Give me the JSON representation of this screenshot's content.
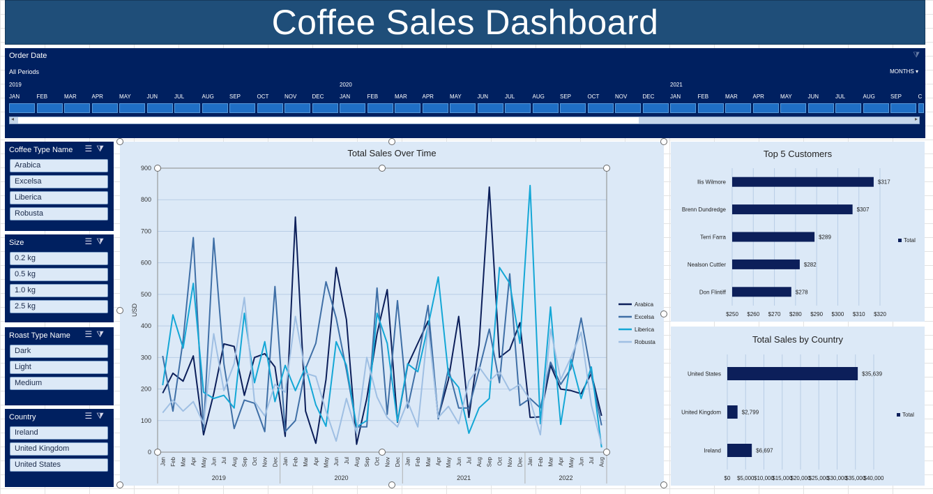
{
  "title": "Coffee Sales Dashboard",
  "timeline": {
    "header": "Order Date",
    "periods": "All Periods",
    "months_button": "MONTHS ▾",
    "years": [
      "2019",
      "2020",
      "2021"
    ],
    "months": [
      "JAN",
      "FEB",
      "MAR",
      "APR",
      "MAY",
      "JUN",
      "JUL",
      "AUG",
      "SEP",
      "OCT",
      "NOV",
      "DEC",
      "JAN",
      "FEB",
      "MAR",
      "APR",
      "MAY",
      "JUN",
      "JUL",
      "AUG",
      "SEP",
      "OCT",
      "NOV",
      "DEC",
      "JAN",
      "FEB",
      "MAR",
      "APR",
      "MAY",
      "JUN",
      "JUL",
      "AUG",
      "SEP",
      "C"
    ]
  },
  "slicers": [
    {
      "title": "Coffee Type Name",
      "items": [
        "Arabica",
        "Excelsa",
        "Liberica",
        "Robusta"
      ]
    },
    {
      "title": "Size",
      "items": [
        "0.2 kg",
        "0.5 kg",
        "1.0 kg",
        "2.5 kg"
      ]
    },
    {
      "title": "Roast Type Name",
      "items": [
        "Dark",
        "Light",
        "Medium"
      ]
    },
    {
      "title": "Country",
      "items": [
        "Ireland",
        "United Kingdom",
        "United States"
      ]
    }
  ],
  "chart_data": [
    {
      "type": "line",
      "title": "Total Sales Over Time",
      "ylabel": "USD",
      "ylim": [
        0,
        900
      ],
      "yticks": [
        "0",
        "100",
        "200",
        "300",
        "400",
        "500",
        "600",
        "700",
        "800",
        "900"
      ],
      "x": [
        "Jan",
        "Feb",
        "Mar",
        "Apr",
        "May",
        "Jun",
        "Jul",
        "Aug",
        "Sep",
        "Oct",
        "Nov",
        "Dec",
        "Jan",
        "Feb",
        "Mar",
        "Apr",
        "May",
        "Jun",
        "Jul",
        "Aug",
        "Sep",
        "Oct",
        "Nov",
        "Dec",
        "Jan",
        "Feb",
        "Mar",
        "Apr",
        "May",
        "Jun",
        "Jul",
        "Aug",
        "Sep",
        "Oct",
        "Nov",
        "Dec",
        "Jan",
        "Feb",
        "Mar",
        "Apr",
        "May",
        "Jun",
        "Jul",
        "Aug"
      ],
      "year_labels": [
        "2019",
        "2020",
        "2021",
        "2022"
      ],
      "legend_position": "right",
      "series": [
        {
          "name": "Arabica",
          "color": "#0c1f5a",
          "values": [
            187,
            250,
            225,
            305,
            55,
            185,
            343,
            335,
            180,
            300,
            312,
            270,
            50,
            745,
            130,
            28,
            230,
            585,
            420,
            25,
            170,
            375,
            515,
            95,
            275,
            345,
            415,
            110,
            230,
            430,
            110,
            340,
            840,
            300,
            325,
            410,
            110,
            112,
            275,
            200,
            195,
            185,
            250,
            115
          ]
        },
        {
          "name": "Excelsa",
          "color": "#3f6fa6",
          "values": [
            305,
            130,
            355,
            680,
            70,
            678,
            280,
            75,
            165,
            155,
            65,
            525,
            65,
            100,
            265,
            345,
            540,
            425,
            260,
            80,
            80,
            520,
            120,
            480,
            140,
            290,
            465,
            105,
            265,
            140,
            140,
            260,
            390,
            220,
            565,
            148,
            170,
            140,
            285,
            215,
            265,
            425,
            245,
            85
          ]
        },
        {
          "name": "Liberica",
          "color": "#14a7d6",
          "values": [
            212,
            435,
            330,
            535,
            190,
            170,
            180,
            140,
            440,
            220,
            350,
            160,
            275,
            195,
            270,
            150,
            82,
            350,
            275,
            80,
            100,
            440,
            345,
            97,
            280,
            255,
            400,
            555,
            245,
            205,
            60,
            140,
            170,
            585,
            535,
            345,
            845,
            90,
            460,
            88,
            295,
            170,
            270,
            15
          ]
        },
        {
          "name": "Robusta",
          "color": "#9fbfe3",
          "values": [
            125,
            165,
            130,
            160,
            90,
            375,
            195,
            280,
            490,
            160,
            115,
            215,
            190,
            430,
            250,
            240,
            130,
            35,
            170,
            60,
            300,
            175,
            110,
            80,
            160,
            80,
            400,
            110,
            145,
            90,
            225,
            270,
            225,
            255,
            195,
            215,
            165,
            55,
            390,
            230,
            300,
            380,
            150,
            25
          ]
        }
      ]
    },
    {
      "type": "bar",
      "title": "Top 5 Customers",
      "categories": [
        "llis Wilmore",
        "Brenn Dundredge",
        "Terri Farra",
        "Nealson Cuttler",
        "Don Flintiff"
      ],
      "values": [
        317,
        307,
        289,
        282,
        278
      ],
      "value_labels": [
        "$317",
        "$307",
        "$289",
        "$282",
        "$278"
      ],
      "xlim": [
        250,
        320
      ],
      "xticks": [
        "$250",
        "$260",
        "$270",
        "$280",
        "$290",
        "$300",
        "$310",
        "$320"
      ],
      "legend": "Total",
      "color": "#0c1f5a"
    },
    {
      "type": "bar",
      "title": "Total Sales by Country",
      "categories": [
        "United States",
        "United Kingdom",
        "Ireland"
      ],
      "values": [
        35639,
        2799,
        6697
      ],
      "value_labels": [
        "$35,639",
        "$2,799",
        "$6,697"
      ],
      "xlim": [
        0,
        40000
      ],
      "xticks": [
        "$0",
        "$5,000",
        "$10,000",
        "$15,000",
        "$20,000",
        "$25,000",
        "$30,000",
        "$35,000",
        "$40,000"
      ],
      "legend": "Total",
      "color": "#0c1f5a"
    }
  ]
}
